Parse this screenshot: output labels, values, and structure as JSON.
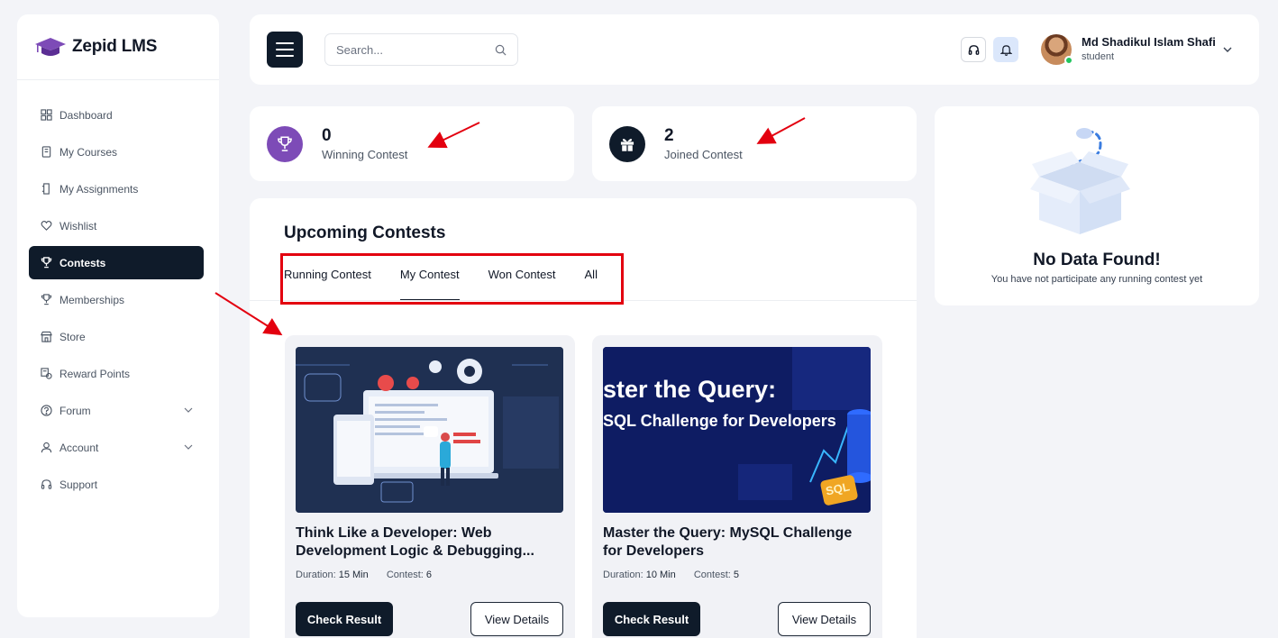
{
  "brand": {
    "name": "Zepid LMS"
  },
  "sidebar": {
    "items": [
      {
        "label": "Dashboard",
        "icon": "dashboard-icon",
        "active": false
      },
      {
        "label": "My Courses",
        "icon": "book-icon",
        "active": false
      },
      {
        "label": "My Assignments",
        "icon": "assignment-icon",
        "active": false
      },
      {
        "label": "Wishlist",
        "icon": "heart-icon",
        "active": false
      },
      {
        "label": "Contests",
        "icon": "trophy-icon",
        "active": true
      },
      {
        "label": "Memberships",
        "icon": "trophy-icon",
        "active": false
      },
      {
        "label": "Store",
        "icon": "store-icon",
        "active": false
      },
      {
        "label": "Reward Points",
        "icon": "reward-icon",
        "active": false
      },
      {
        "label": "Forum",
        "icon": "help-circle-icon",
        "active": false,
        "expandable": true
      },
      {
        "label": "Account",
        "icon": "user-icon",
        "active": false,
        "expandable": true
      },
      {
        "label": "Support",
        "icon": "headset-icon",
        "active": false
      }
    ]
  },
  "header": {
    "search_placeholder": "Search...",
    "user_name": "Md Shadikul Islam Shafi",
    "user_role": "student"
  },
  "stats": {
    "winning": {
      "value": "0",
      "label": "Winning Contest"
    },
    "joined": {
      "value": "2",
      "label": "Joined Contest"
    }
  },
  "contests": {
    "title": "Upcoming Contests",
    "tabs": [
      {
        "label": "Running Contest",
        "active": false
      },
      {
        "label": "My Contest",
        "active": true
      },
      {
        "label": "Won Contest",
        "active": false
      },
      {
        "label": "All",
        "active": false
      }
    ],
    "cards": [
      {
        "title": "Think Like a Developer: Web Development Logic & Debugging...",
        "duration_label": "Duration:",
        "duration": "15 Min",
        "contest_label": "Contest:",
        "contest": "6",
        "result_button": "Check Result",
        "details_button": "View Details"
      },
      {
        "title": "Master the Query: MySQL Challenge for Developers",
        "duration_label": "Duration:",
        "duration": "10 Min",
        "contest_label": "Contest:",
        "contest": "5",
        "result_button": "Check Result",
        "details_button": "View Details",
        "banner_line1": "ster the Query:",
        "banner_line2": "SQL Challenge for Developers",
        "banner_badge": "SQL"
      }
    ]
  },
  "nodata": {
    "title": "No Data Found!",
    "subtitle": "You have not participate any running contest yet"
  },
  "colors": {
    "navy": "#0f1b2a",
    "purple": "#7d4bb7",
    "annotation_red": "#e3000f",
    "bell_bg": "#dbe7fb"
  }
}
